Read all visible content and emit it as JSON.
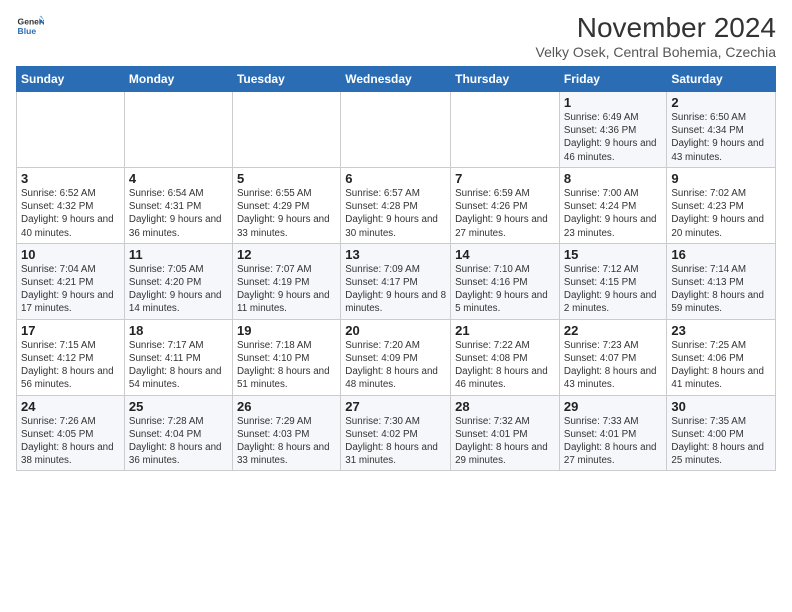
{
  "logo": {
    "line1": "General",
    "line2": "Blue"
  },
  "title": "November 2024",
  "location": "Velky Osek, Central Bohemia, Czechia",
  "days_of_week": [
    "Sunday",
    "Monday",
    "Tuesday",
    "Wednesday",
    "Thursday",
    "Friday",
    "Saturday"
  ],
  "weeks": [
    [
      {
        "day": "",
        "info": ""
      },
      {
        "day": "",
        "info": ""
      },
      {
        "day": "",
        "info": ""
      },
      {
        "day": "",
        "info": ""
      },
      {
        "day": "",
        "info": ""
      },
      {
        "day": "1",
        "info": "Sunrise: 6:49 AM\nSunset: 4:36 PM\nDaylight: 9 hours and 46 minutes."
      },
      {
        "day": "2",
        "info": "Sunrise: 6:50 AM\nSunset: 4:34 PM\nDaylight: 9 hours and 43 minutes."
      }
    ],
    [
      {
        "day": "3",
        "info": "Sunrise: 6:52 AM\nSunset: 4:32 PM\nDaylight: 9 hours and 40 minutes."
      },
      {
        "day": "4",
        "info": "Sunrise: 6:54 AM\nSunset: 4:31 PM\nDaylight: 9 hours and 36 minutes."
      },
      {
        "day": "5",
        "info": "Sunrise: 6:55 AM\nSunset: 4:29 PM\nDaylight: 9 hours and 33 minutes."
      },
      {
        "day": "6",
        "info": "Sunrise: 6:57 AM\nSunset: 4:28 PM\nDaylight: 9 hours and 30 minutes."
      },
      {
        "day": "7",
        "info": "Sunrise: 6:59 AM\nSunset: 4:26 PM\nDaylight: 9 hours and 27 minutes."
      },
      {
        "day": "8",
        "info": "Sunrise: 7:00 AM\nSunset: 4:24 PM\nDaylight: 9 hours and 23 minutes."
      },
      {
        "day": "9",
        "info": "Sunrise: 7:02 AM\nSunset: 4:23 PM\nDaylight: 9 hours and 20 minutes."
      }
    ],
    [
      {
        "day": "10",
        "info": "Sunrise: 7:04 AM\nSunset: 4:21 PM\nDaylight: 9 hours and 17 minutes."
      },
      {
        "day": "11",
        "info": "Sunrise: 7:05 AM\nSunset: 4:20 PM\nDaylight: 9 hours and 14 minutes."
      },
      {
        "day": "12",
        "info": "Sunrise: 7:07 AM\nSunset: 4:19 PM\nDaylight: 9 hours and 11 minutes."
      },
      {
        "day": "13",
        "info": "Sunrise: 7:09 AM\nSunset: 4:17 PM\nDaylight: 9 hours and 8 minutes."
      },
      {
        "day": "14",
        "info": "Sunrise: 7:10 AM\nSunset: 4:16 PM\nDaylight: 9 hours and 5 minutes."
      },
      {
        "day": "15",
        "info": "Sunrise: 7:12 AM\nSunset: 4:15 PM\nDaylight: 9 hours and 2 minutes."
      },
      {
        "day": "16",
        "info": "Sunrise: 7:14 AM\nSunset: 4:13 PM\nDaylight: 8 hours and 59 minutes."
      }
    ],
    [
      {
        "day": "17",
        "info": "Sunrise: 7:15 AM\nSunset: 4:12 PM\nDaylight: 8 hours and 56 minutes."
      },
      {
        "day": "18",
        "info": "Sunrise: 7:17 AM\nSunset: 4:11 PM\nDaylight: 8 hours and 54 minutes."
      },
      {
        "day": "19",
        "info": "Sunrise: 7:18 AM\nSunset: 4:10 PM\nDaylight: 8 hours and 51 minutes."
      },
      {
        "day": "20",
        "info": "Sunrise: 7:20 AM\nSunset: 4:09 PM\nDaylight: 8 hours and 48 minutes."
      },
      {
        "day": "21",
        "info": "Sunrise: 7:22 AM\nSunset: 4:08 PM\nDaylight: 8 hours and 46 minutes."
      },
      {
        "day": "22",
        "info": "Sunrise: 7:23 AM\nSunset: 4:07 PM\nDaylight: 8 hours and 43 minutes."
      },
      {
        "day": "23",
        "info": "Sunrise: 7:25 AM\nSunset: 4:06 PM\nDaylight: 8 hours and 41 minutes."
      }
    ],
    [
      {
        "day": "24",
        "info": "Sunrise: 7:26 AM\nSunset: 4:05 PM\nDaylight: 8 hours and 38 minutes."
      },
      {
        "day": "25",
        "info": "Sunrise: 7:28 AM\nSunset: 4:04 PM\nDaylight: 8 hours and 36 minutes."
      },
      {
        "day": "26",
        "info": "Sunrise: 7:29 AM\nSunset: 4:03 PM\nDaylight: 8 hours and 33 minutes."
      },
      {
        "day": "27",
        "info": "Sunrise: 7:30 AM\nSunset: 4:02 PM\nDaylight: 8 hours and 31 minutes."
      },
      {
        "day": "28",
        "info": "Sunrise: 7:32 AM\nSunset: 4:01 PM\nDaylight: 8 hours and 29 minutes."
      },
      {
        "day": "29",
        "info": "Sunrise: 7:33 AM\nSunset: 4:01 PM\nDaylight: 8 hours and 27 minutes."
      },
      {
        "day": "30",
        "info": "Sunrise: 7:35 AM\nSunset: 4:00 PM\nDaylight: 8 hours and 25 minutes."
      }
    ]
  ]
}
